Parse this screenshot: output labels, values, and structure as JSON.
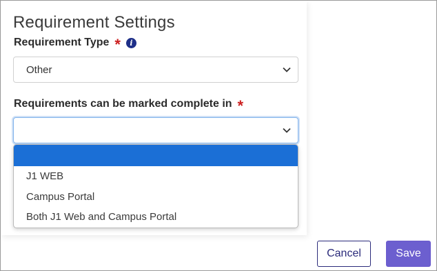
{
  "dialog": {
    "title": "Requirement Settings"
  },
  "requirement_type": {
    "label": "Requirement Type",
    "required_mark": "*",
    "info_icon": "info-icon",
    "selected_value": "Other"
  },
  "complete_in": {
    "label": "Requirements can be marked complete in",
    "required_mark": "*",
    "selected_value": "",
    "options": [
      "",
      "J1 WEB",
      "Campus Portal",
      "Both J1 Web and Campus Portal"
    ]
  },
  "actions": {
    "cancel_label": "Cancel",
    "save_label": "Save"
  },
  "colors": {
    "accent": "#6c5fcf",
    "highlight": "#1b6fd6",
    "required": "#cc1f1f",
    "cancel_border": "#2a2a7a"
  }
}
